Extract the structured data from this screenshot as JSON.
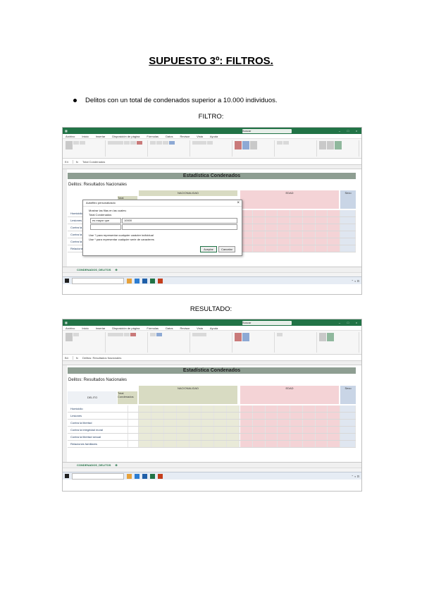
{
  "document": {
    "title": "SUPUESTO 3º: FILTROS.",
    "bullet": "Delitos con un total de condenados superior a 10.000 individuos.",
    "caption_filter": "FILTRO:",
    "caption_result": "RESULTADO:"
  },
  "spreadsheet": {
    "search_placeholder": "Buscar",
    "menu": [
      "Archivo",
      "Inicio",
      "Insertar",
      "Disposición de página",
      "Fórmulas",
      "Datos",
      "Revisar",
      "Vista",
      "Ayuda"
    ],
    "banner": "Estadística Condenados",
    "subtitle": "Delitos: Resultados Nacionales",
    "band_nationality": "NACIONALIDAD",
    "band_age": "EDAD",
    "band_sex": "Sexo",
    "sheet_tab": "CONDENADOS_DELITOS",
    "col_delito": "DELITO",
    "col_total": "Total Condenados"
  },
  "filter_shot": {
    "cell_ref": "E4",
    "formula": "Total Condenados",
    "rows": [
      "Homicidio",
      "Lesiones",
      "Contra la libertad",
      "Contra la integridad moral",
      "Contra la libertad sexual",
      "Relaciones familiares"
    ],
    "dialog": {
      "title": "Autofiltro personalizado",
      "show_rows": "Mostrar las filas en las cuales:",
      "field": "Total Condenados",
      "operator": "es mayor que",
      "value": "10000",
      "hint1": "Use ? para representar cualquier carácter individual",
      "hint2": "Use * para representar cualquier serie de caracteres",
      "ok": "Aceptar",
      "cancel": "Cancelar"
    }
  },
  "result_shot": {
    "cell_ref": "B4",
    "formula": "Delitos: Resultados Nacionales",
    "rows": [
      "Homicidio",
      "Lesiones",
      "Contra la libertad",
      "Contra la integridad moral",
      "Contra la libertad sexual",
      "Relaciones familiares"
    ]
  }
}
